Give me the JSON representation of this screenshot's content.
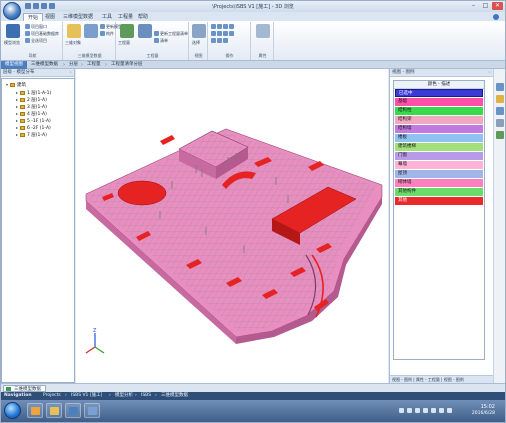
{
  "window": {
    "title": "\\Projects\\ISBS V1 [施工] - 3D 浏览"
  },
  "ribbon_tabs": [
    {
      "label": "开始",
      "active": true
    },
    {
      "label": "视图",
      "active": false
    },
    {
      "label": "三维模型数据",
      "active": false
    },
    {
      "label": "工具",
      "active": false
    },
    {
      "label": "工程量",
      "active": false
    },
    {
      "label": "帮助",
      "active": false
    }
  ],
  "ribbon": {
    "groups": [
      {
        "name": "导航",
        "big_label": "模型浏览",
        "small": [
          "项目窗口",
          "项目基础数据库",
          "全选项目"
        ]
      },
      {
        "name": "三维模型数据",
        "big_label": "三维对象",
        "small": [
          "更新模型",
          "构件"
        ]
      },
      {
        "name": "工程量",
        "big_label": "工程量",
        "small": [
          "更新工程量清单",
          "清单"
        ]
      },
      {
        "name": "视图",
        "big_label": "选择",
        "small": []
      },
      {
        "name": "操作",
        "big_label": "",
        "small": []
      },
      {
        "name": "属性",
        "big_label": "",
        "small": []
      }
    ]
  },
  "breadcrumbs": [
    "模型视图",
    "三维模型数据",
    "分层",
    "工程量",
    "工程量清单分层"
  ],
  "left_panel": {
    "title": "层级 - 模型分布",
    "root": "建筑",
    "items": [
      "1 层(1-A-1)",
      "2 层(1-A)",
      "3 层(1-A)",
      "4 层(1-A)",
      "5 -1F (1-A)",
      "6 -2F (1-A)",
      "7 层(1-A)"
    ]
  },
  "right_panel": {
    "title": "视图 - 图例",
    "legend_header": "颜色 - 描述",
    "legend": [
      {
        "label": "已选中",
        "color": "#3a3ad6",
        "text_color": "#ffffff"
      },
      {
        "label": "基础",
        "color": "#ff4fa8",
        "text_color": "#111111"
      },
      {
        "label": "结构柱",
        "color": "#38d94a",
        "text_color": "#111111"
      },
      {
        "label": "结构梁",
        "color": "#f1a9c2",
        "text_color": "#111111"
      },
      {
        "label": "结构墙",
        "color": "#c27ae0",
        "text_color": "#111111"
      },
      {
        "label": "楼板",
        "color": "#8fc1f2",
        "text_color": "#111111"
      },
      {
        "label": "建筑楼梯",
        "color": "#a4e07a",
        "text_color": "#111111"
      },
      {
        "label": "门窗",
        "color": "#b79be8",
        "text_color": "#111111"
      },
      {
        "label": "幕墙",
        "color": "#ffb3d6",
        "text_color": "#111111"
      },
      {
        "label": "屋顶",
        "color": "#9fb6e6",
        "text_color": "#111111"
      },
      {
        "label": "砌体墙",
        "color": "#ff7fbf",
        "text_color": "#111111"
      },
      {
        "label": "其他构件",
        "color": "#6bdc6b",
        "text_color": "#111111"
      },
      {
        "label": "其他",
        "color": "#e82a2a",
        "text_color": "#ffffff"
      }
    ],
    "bottom_tabs": "视图 - 图例 | 属性 - 工程量 | 视图 - 图例"
  },
  "doc_tab": "三维模型数据",
  "navigation": {
    "label": "Navigation",
    "path": [
      "Projects",
      "ISBS V1 [施工]",
      "模型分析",
      "ISBS",
      "三维模型数据"
    ]
  },
  "taskbar": {
    "time": "15:02",
    "date": "2016/6/28"
  },
  "model_colors": {
    "slab": "#e98ec0",
    "structure_red": "#e52323",
    "gray": "#8a8a8a"
  }
}
